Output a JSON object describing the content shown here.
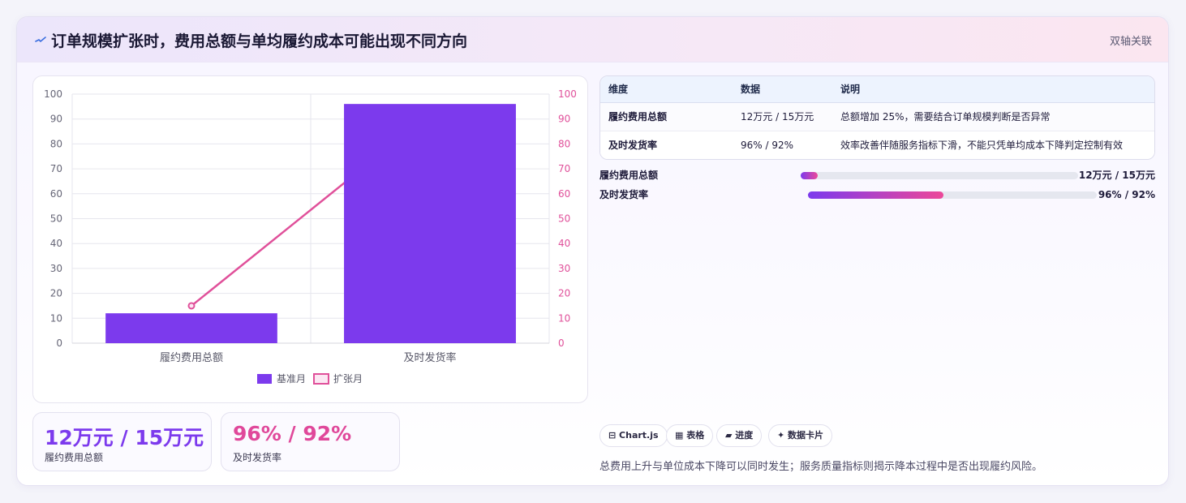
{
  "header": {
    "title": "订单规模扩张时，费用总额与单均履约成本可能出现不同方向",
    "tag": "双轴关联",
    "icon": "pulse-icon"
  },
  "chart_data": {
    "type": "bar",
    "categories": [
      "履约费用总额",
      "及时发货率"
    ],
    "series": [
      {
        "name": "基准月",
        "type": "bar",
        "axis": "left",
        "values": [
          12,
          96
        ],
        "color": "#7c3aed"
      },
      {
        "name": "扩张月",
        "type": "line",
        "axis": "right",
        "values": [
          15,
          92
        ],
        "color": "#e0509a"
      }
    ],
    "y_left": {
      "min": 0,
      "max": 100,
      "ticks": [
        0,
        10,
        20,
        30,
        40,
        50,
        60,
        70,
        80,
        90,
        100
      ]
    },
    "y_right": {
      "min": 0,
      "max": 100,
      "ticks": [
        0,
        10,
        20,
        30,
        40,
        50,
        60,
        70,
        80,
        90,
        100
      ]
    },
    "grid": true,
    "legend_position": "bottom"
  },
  "stats": [
    {
      "value": "12万元 / 15万元",
      "label": "履约费用总额",
      "color": "#7c3aed"
    },
    {
      "value": "96% / 92%",
      "label": "及时发货率",
      "color": "#e0489a"
    }
  ],
  "table": {
    "headers": [
      "维度",
      "数据",
      "说明"
    ],
    "rows": [
      [
        "履约费用总额",
        "12万元 / 15万元",
        "总额增加 25%，需要结合订单规模判断是否异常"
      ],
      [
        "及时发货率",
        "96% / 92%",
        "效率改善伴随服务指标下滑，不能只凭单均成本下降判定控制有效"
      ]
    ]
  },
  "progress": [
    {
      "label": "履约费用总额",
      "value_text": "12万元 / 15万元",
      "fraction": 0.06
    },
    {
      "label": "及时发货率",
      "value_text": "96% / 92%",
      "fraction": 0.47
    }
  ],
  "chips": [
    {
      "label": "⊟ Chart.js",
      "icon": "chart-icon"
    },
    {
      "label": "▦ 表格",
      "icon": "table-icon"
    },
    {
      "label": "▰ 进度",
      "icon": "progress-icon"
    },
    {
      "label": "✦ 数据卡片",
      "icon": "card-icon"
    }
  ],
  "note": "总费用上升与单位成本下降可以同时发生；服务质量指标则揭示降本过程中是否出现履约风险。"
}
